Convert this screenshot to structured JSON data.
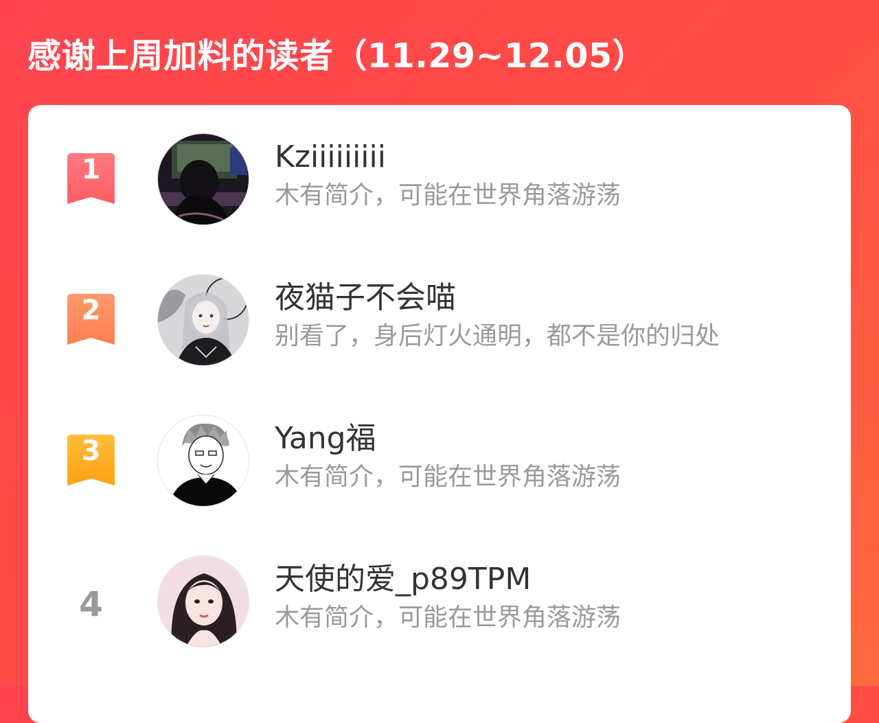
{
  "header": {
    "title": "感谢上周加料的读者（11.29~12.05）"
  },
  "readers": [
    {
      "rank": "1",
      "name": "Kziiiiiiiii",
      "bio": "木有简介，可能在世界角落游荡",
      "badge_color": "#ff6b6e",
      "avatar": "avatar-girl-dark-room"
    },
    {
      "rank": "2",
      "name": "夜猫子不会喵",
      "bio": "别看了，身后灯火通明，都不是你的归处",
      "badge_color": "#ff8a5b",
      "avatar": "avatar-anime-girl-grey"
    },
    {
      "rank": "3",
      "name": "Yang福",
      "bio": "木有简介，可能在世界角落游荡",
      "badge_color": "#ffb020",
      "avatar": "avatar-anime-boy-sketch"
    },
    {
      "rank": "4",
      "name": "天使的爱_p89TPM",
      "bio": "木有简介，可能在世界角落游荡",
      "badge_color": "",
      "avatar": "avatar-girl-portrait"
    }
  ]
}
